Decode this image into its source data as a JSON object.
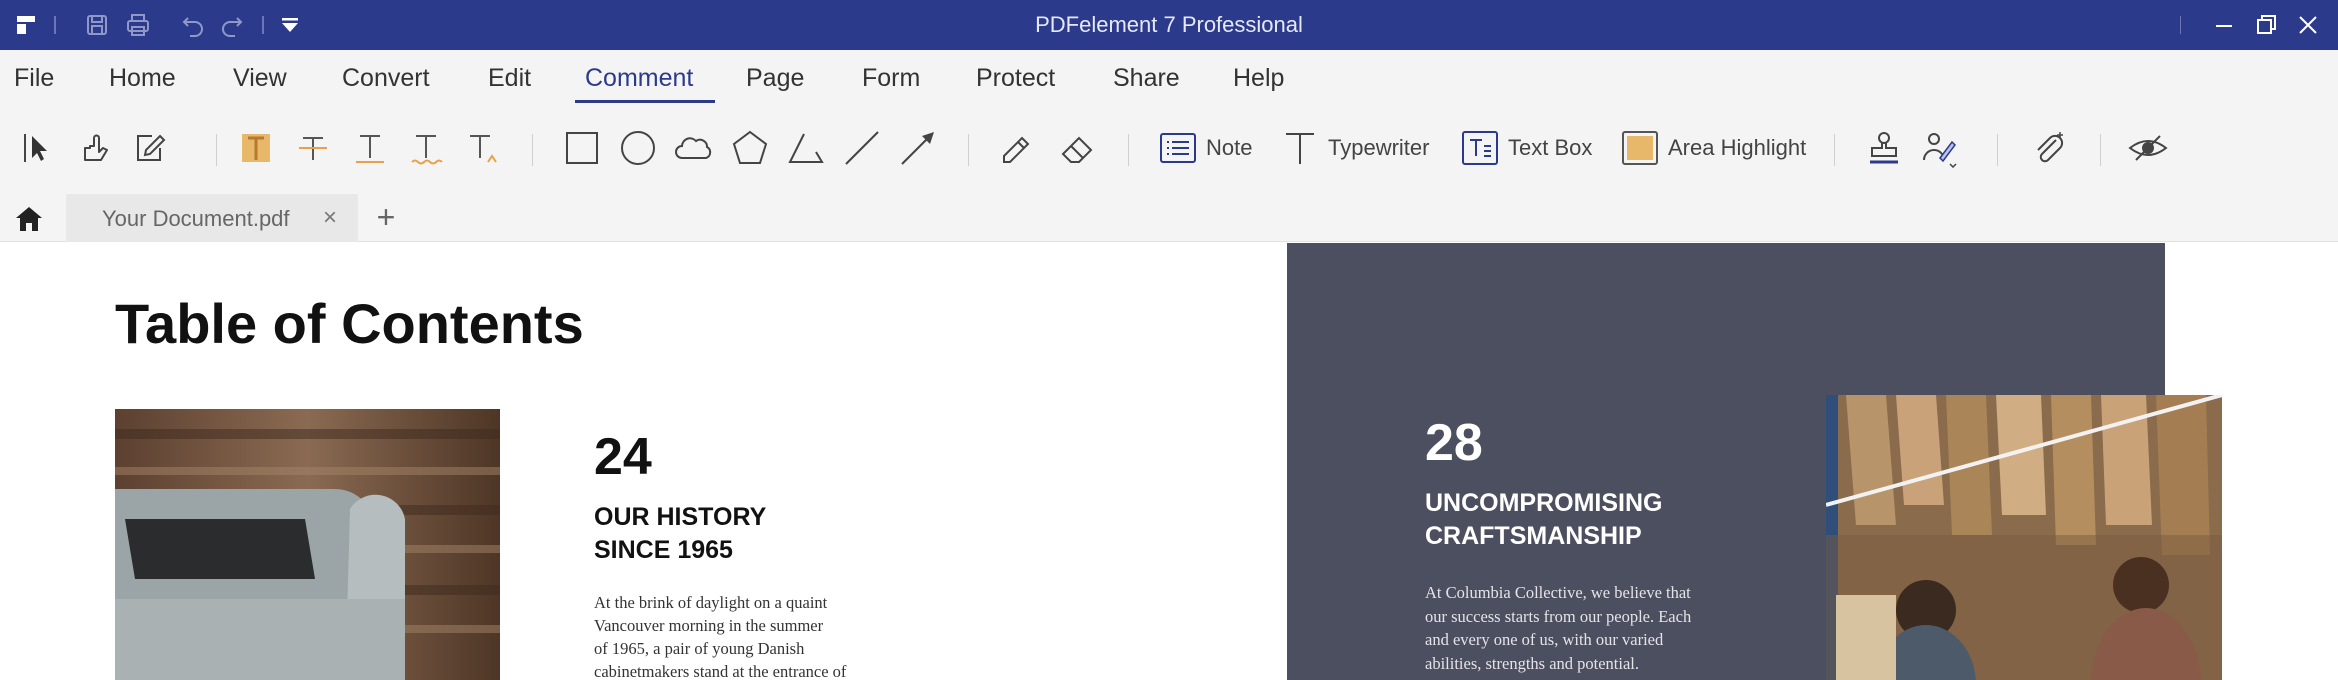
{
  "window": {
    "title": "PDFelement 7 Professional"
  },
  "quick_access": {
    "icons": [
      "app-logo-icon",
      "save-icon",
      "print-icon",
      "undo-icon",
      "redo-icon",
      "customize-dropdown-icon"
    ]
  },
  "menu": {
    "items": [
      "File",
      "Home",
      "View",
      "Convert",
      "Edit",
      "Comment",
      "Page",
      "Form",
      "Protect",
      "Share",
      "Help"
    ],
    "active": "Comment"
  },
  "toolbar": {
    "note_label": "Note",
    "typewriter_label": "Typewriter",
    "textbox_label": "Text Box",
    "area_highlight_label": "Area Highlight"
  },
  "tabs": {
    "document": "Your Document.pdf",
    "close_glyph": "×",
    "add_glyph": "+"
  },
  "document": {
    "title": "Table of Contents",
    "section1": {
      "number": "24",
      "heading_lines": [
        "OUR HISTORY",
        "SINCE 1965"
      ],
      "body_lines": [
        "At the brink of daylight on a quaint",
        "Vancouver morning in the summer",
        "of 1965, a pair of young Danish",
        "cabinetmakers stand at the entrance of"
      ]
    },
    "section2": {
      "number": "28",
      "heading_lines": [
        "UNCOMPROMISING",
        "CRAFTSMANSHIP"
      ],
      "body_lines": [
        "At Columbia Collective, we believe that",
        "our success starts from our people. Each",
        "and every one of us, with our varied",
        "abilities, strengths and potential."
      ]
    }
  },
  "colors": {
    "titlebar": "#2c3a8c",
    "menu_active": "#2c3a8c",
    "toolbar_bg": "#f4f4f4",
    "highlight_fill": "#e8b86a",
    "dark_panel": "#4c4f5f"
  }
}
